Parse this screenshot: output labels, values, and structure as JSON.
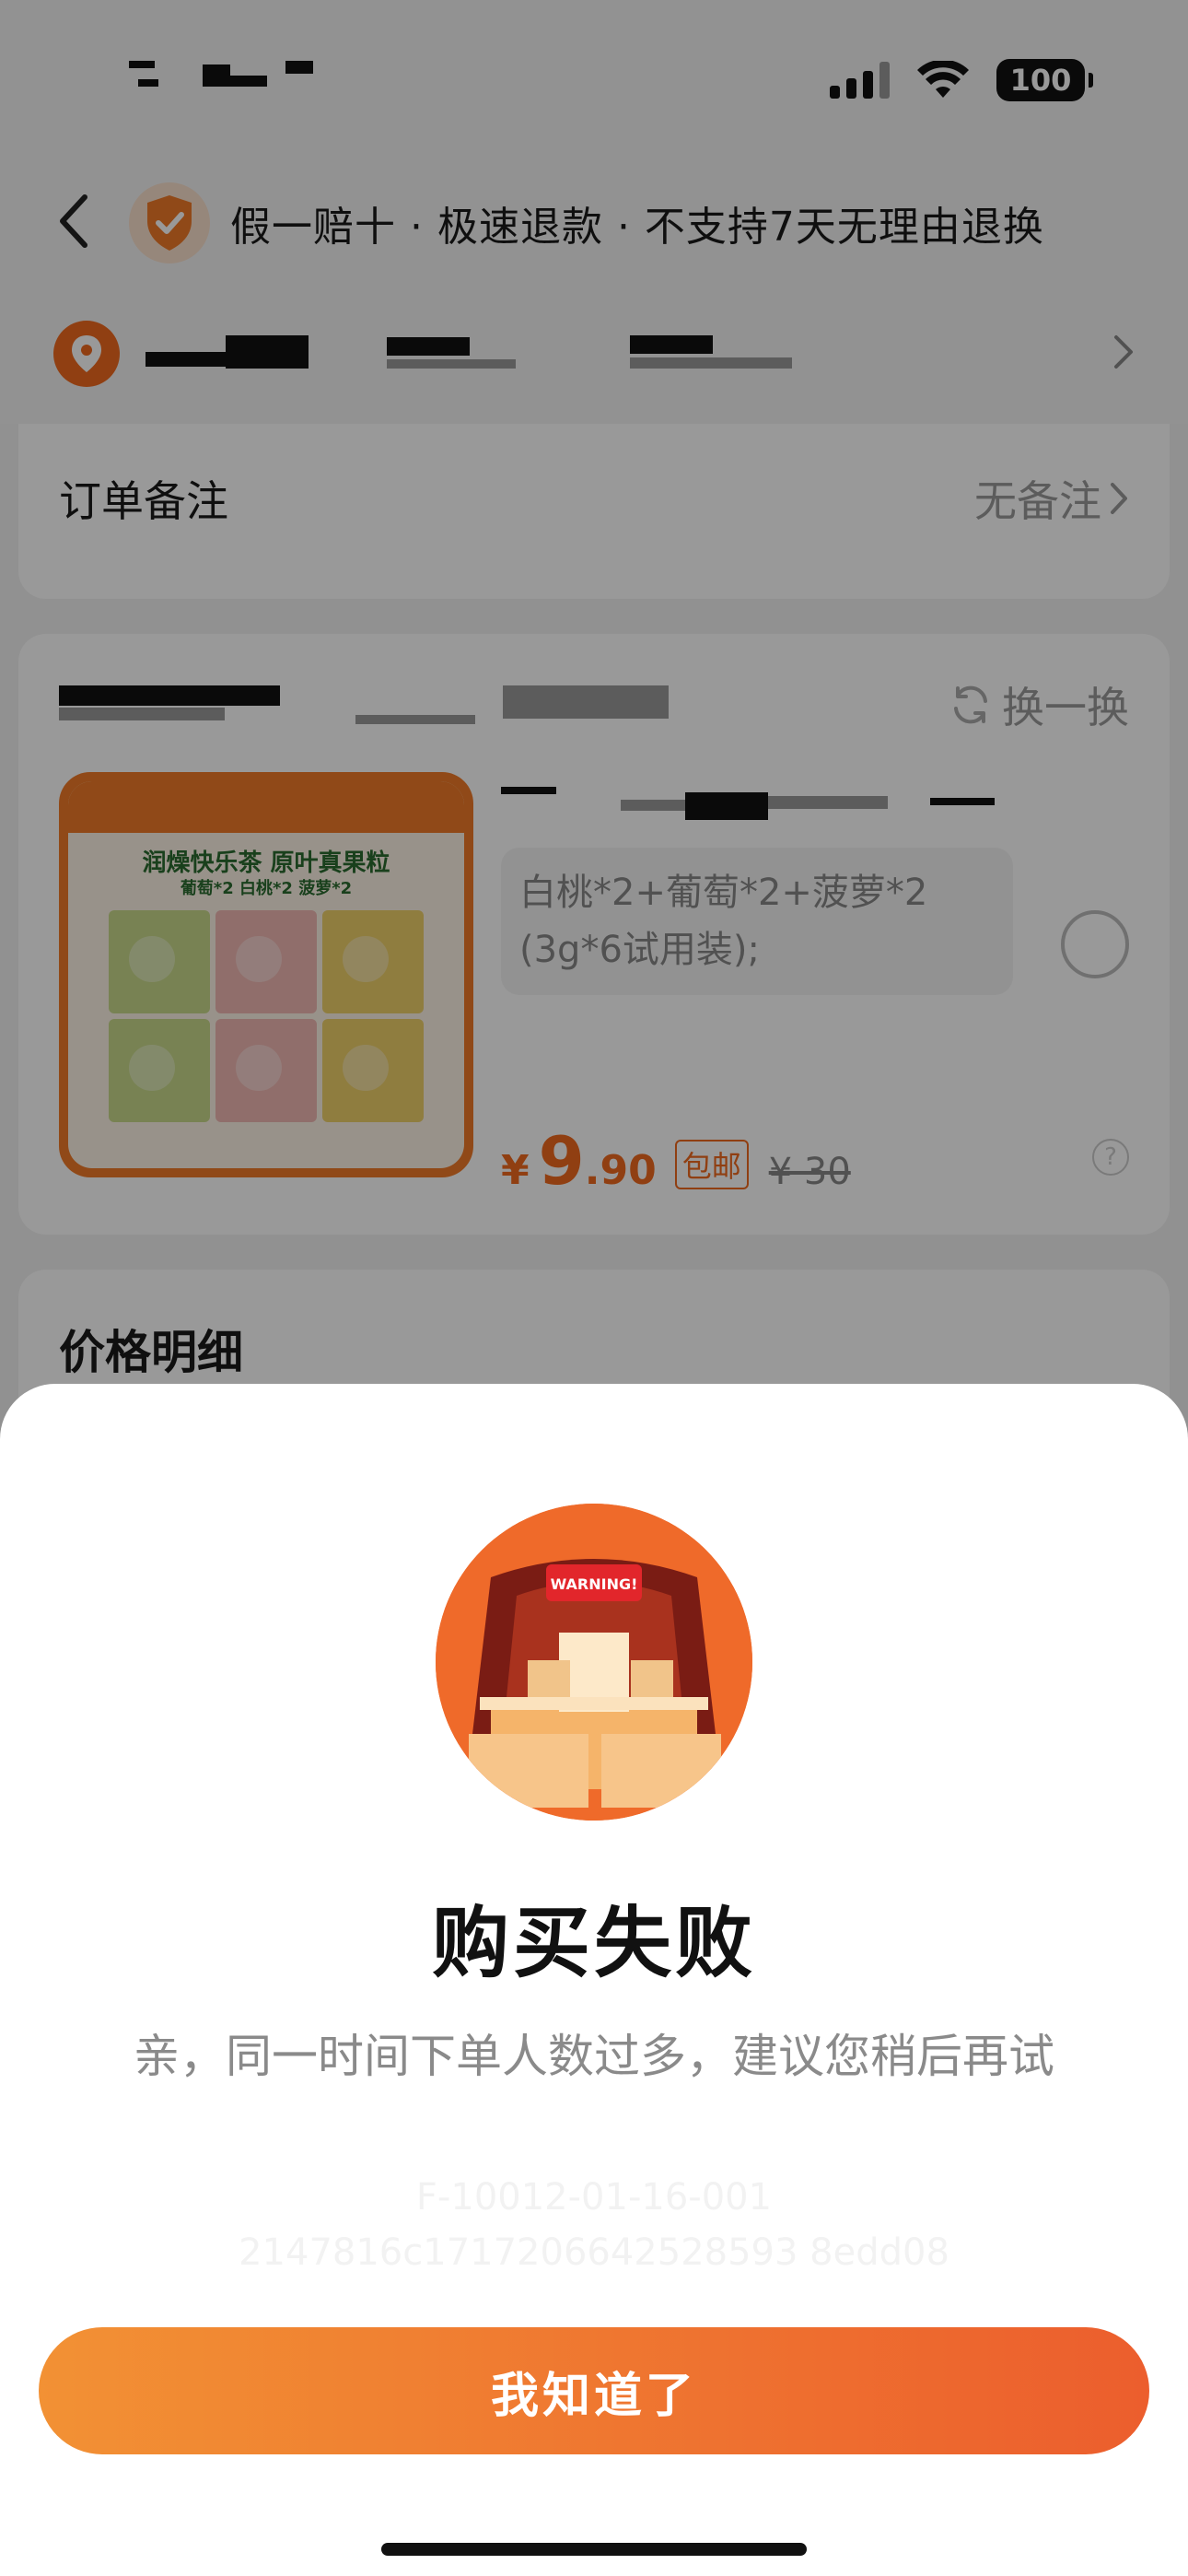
{
  "status_bar": {
    "battery": "100"
  },
  "header": {
    "title": "假一赔十 · 极速退款 · 不支持7天无理由退换"
  },
  "order_note": {
    "label": "订单备注",
    "value": "无备注"
  },
  "product": {
    "swap_label": "换一换",
    "image_tagline": "润燥快乐茶  原叶真果粒",
    "image_sub": "葡萄*2  白桃*2  菠萝*2",
    "sku_line1": "白桃*2+葡萄*2+菠萝*2",
    "sku_line2": "(3g*6试用装);",
    "price_currency": "¥",
    "price_int": "9",
    "price_dec": ".90",
    "shipping_tag": "包邮",
    "original_price": "¥ 30",
    "help_mark": "?"
  },
  "price_detail": {
    "title": "价格明细"
  },
  "dialog": {
    "badge_text": "WARNING!",
    "title": "购买失败",
    "message": "亲，同一时间下单人数过多，建议您稍后再试",
    "code_line1": "F-10012-01-16-001",
    "code_line2": "2147816c1717206642528593 8edd08",
    "confirm_label": "我知道了"
  },
  "colors": {
    "accent": "#f06a1e",
    "button_start": "#f29134",
    "button_end": "#ec5e2d"
  }
}
